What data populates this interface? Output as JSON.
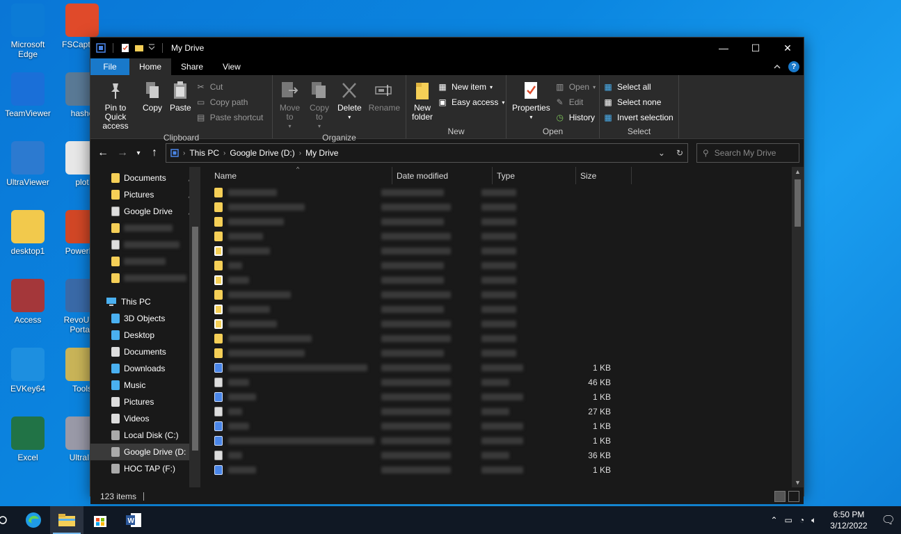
{
  "desktop": {
    "icons": [
      {
        "label": "Microsoft Edge",
        "color": "#0c7bd6"
      },
      {
        "label": "FSCapture",
        "color": "#e04a2a"
      },
      {
        "label": "TeamViewer",
        "color": "#1a6fd8"
      },
      {
        "label": "hashe",
        "color": "#5a7a96"
      },
      {
        "label": "UltraViewer",
        "color": "#2c7ad0"
      },
      {
        "label": "plot",
        "color": "#e8e8e8"
      },
      {
        "label": "desktop1",
        "color": "#f2c94c"
      },
      {
        "label": "PowerPo",
        "color": "#d24726"
      },
      {
        "label": "Access",
        "color": "#a4373a"
      },
      {
        "label": "RevoUnin Portab",
        "color": "#3a6aa8"
      },
      {
        "label": "EVKey64",
        "color": "#1d8fe0"
      },
      {
        "label": "Tools",
        "color": "#c9b458"
      },
      {
        "label": "Excel",
        "color": "#217346"
      },
      {
        "label": "UltraIS",
        "color": "#9a9aa8"
      }
    ]
  },
  "window": {
    "title": "My Drive",
    "controls": {
      "minimize": "—",
      "maximize": "☐",
      "close": "✕"
    }
  },
  "tabs": {
    "file": "File",
    "home": "Home",
    "share": "Share",
    "view": "View"
  },
  "ribbon": {
    "clipboard": {
      "label": "Clipboard",
      "pin": "Pin to Quick access",
      "copy": "Copy",
      "paste": "Paste",
      "cut": "Cut",
      "copy_path": "Copy path",
      "paste_shortcut": "Paste shortcut"
    },
    "organize": {
      "label": "Organize",
      "move_to": "Move to",
      "copy_to": "Copy to",
      "delete": "Delete",
      "rename": "Rename"
    },
    "new": {
      "label": "New",
      "new_folder": "New folder",
      "new_item": "New item",
      "easy_access": "Easy access"
    },
    "open": {
      "label": "Open",
      "properties": "Properties",
      "open": "Open",
      "edit": "Edit",
      "history": "History"
    },
    "select": {
      "label": "Select",
      "select_all": "Select all",
      "select_none": "Select none",
      "invert": "Invert selection"
    }
  },
  "address": {
    "crumbs": [
      "This PC",
      "Google Drive (D:)",
      "My Drive"
    ],
    "search_placeholder": "Search My Drive"
  },
  "nav": {
    "quick": [
      {
        "label": "Documents"
      },
      {
        "label": "Pictures"
      },
      {
        "label": "Google Drive"
      }
    ],
    "this_pc": "This PC",
    "pc_items": [
      {
        "label": "3D Objects"
      },
      {
        "label": "Desktop"
      },
      {
        "label": "Documents"
      },
      {
        "label": "Downloads"
      },
      {
        "label": "Music"
      },
      {
        "label": "Pictures"
      },
      {
        "label": "Videos"
      },
      {
        "label": "Local Disk (C:)"
      },
      {
        "label": "Google Drive (D:"
      },
      {
        "label": "HOC TAP (F:)"
      }
    ]
  },
  "columns": {
    "name": "Name",
    "date": "Date modified",
    "type": "Type",
    "size": "Size"
  },
  "files": [
    {
      "kind": "folder",
      "size": ""
    },
    {
      "kind": "folder",
      "size": ""
    },
    {
      "kind": "folder",
      "size": ""
    },
    {
      "kind": "folder",
      "size": ""
    },
    {
      "kind": "shared",
      "size": ""
    },
    {
      "kind": "folder",
      "size": ""
    },
    {
      "kind": "shared",
      "size": ""
    },
    {
      "kind": "folder",
      "size": ""
    },
    {
      "kind": "shared",
      "size": ""
    },
    {
      "kind": "shared",
      "size": ""
    },
    {
      "kind": "folder",
      "size": ""
    },
    {
      "kind": "folder",
      "size": ""
    },
    {
      "kind": "doc",
      "size": "1 KB"
    },
    {
      "kind": "img",
      "size": "46 KB"
    },
    {
      "kind": "doc",
      "size": "1 KB"
    },
    {
      "kind": "img",
      "size": "27 KB"
    },
    {
      "kind": "doc",
      "size": "1 KB"
    },
    {
      "kind": "doc",
      "size": "1 KB"
    },
    {
      "kind": "img",
      "size": "36 KB"
    },
    {
      "kind": "doc",
      "size": "1 KB"
    }
  ],
  "status": {
    "count": "123 items"
  },
  "taskbar": {
    "time": "6:50 PM",
    "date": "3/12/2022"
  }
}
